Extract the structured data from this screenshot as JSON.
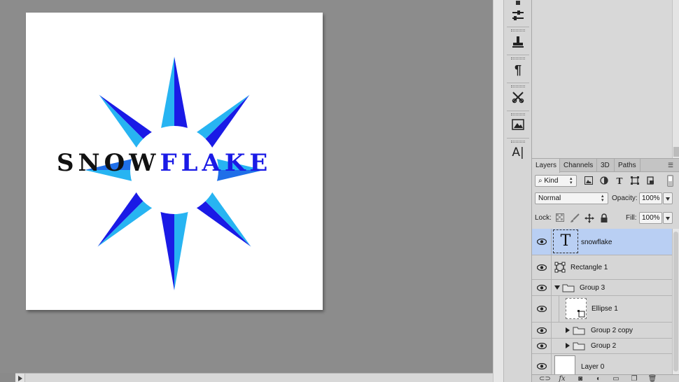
{
  "document": {
    "logo_word_black": "SNOW",
    "logo_word_blue": "FLAKE",
    "colors": {
      "dark_blue": "#1a1ae6",
      "mid_blue": "#1f6fe8",
      "light_blue": "#27b4f2",
      "black": "#111111",
      "white": "#ffffff"
    }
  },
  "layers_panel": {
    "tabs": [
      {
        "label": "Layers",
        "active": true
      },
      {
        "label": "Channels",
        "active": false
      },
      {
        "label": "3D",
        "active": false
      },
      {
        "label": "Paths",
        "active": false
      }
    ],
    "filter": {
      "kind_label": "Kind"
    },
    "blend_mode": "Normal",
    "opacity_label": "Opacity:",
    "opacity_value": "100%",
    "lock_label": "Lock:",
    "fill_label": "Fill:",
    "fill_value": "100%",
    "layers": [
      {
        "name": "snowflake",
        "type": "text",
        "selected": true
      },
      {
        "name": "Rectangle 1",
        "type": "shape",
        "selected": false
      },
      {
        "name": "Group 3",
        "type": "group-open",
        "selected": false
      },
      {
        "name": "Ellipse 1",
        "type": "shape-thumb",
        "selected": false
      },
      {
        "name": "Group 2 copy",
        "type": "group-closed",
        "selected": false
      },
      {
        "name": "Group 2",
        "type": "group-closed",
        "selected": false
      },
      {
        "name": "Layer 0",
        "type": "pixel",
        "selected": false
      }
    ],
    "bottom_icons": [
      "link-icon",
      "fx-icon",
      "mask-icon",
      "adjustment-icon",
      "folder-icon",
      "new-layer-icon",
      "trash-icon"
    ]
  },
  "dock": {
    "tools": [
      "adjustments-icon",
      "clone-source-icon",
      "paragraph-icon",
      "tool-presets-icon",
      "image-layer-icon",
      "character-icon"
    ]
  }
}
